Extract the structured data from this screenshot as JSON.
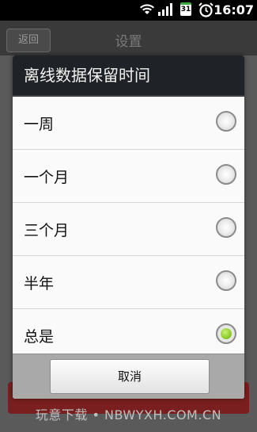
{
  "status_bar": {
    "time": "16:07",
    "icons": [
      "wifi-icon",
      "signal-icon",
      "calendar-icon",
      "alarm-icon"
    ],
    "calendar_badge": "31"
  },
  "app_bar": {
    "back_label": "返回",
    "title": "设置"
  },
  "dialog": {
    "title": "离线数据保留时间",
    "options": [
      {
        "label": "一周",
        "checked": false
      },
      {
        "label": "一个月",
        "checked": false
      },
      {
        "label": "三个月",
        "checked": false
      },
      {
        "label": "半年",
        "checked": false
      },
      {
        "label": "总是",
        "checked": true
      }
    ],
    "cancel_label": "取消"
  },
  "watermark": "玩意下载 • NBWYXH.COM.CN",
  "colors": {
    "dialog_title_bg": "#1f2226",
    "radio_checked": "#8fcc2a",
    "footer_bg": "#a9a9a9"
  }
}
